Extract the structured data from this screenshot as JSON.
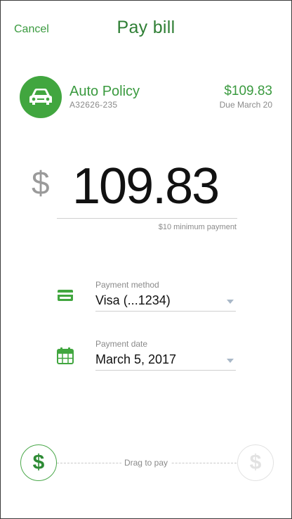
{
  "header": {
    "cancel_label": "Cancel",
    "title": "Pay bill"
  },
  "policy": {
    "icon": "car-icon",
    "name": "Auto Policy",
    "number": "A32626-235",
    "amount": "$109.83",
    "due": "Due March 20"
  },
  "payment": {
    "currency_symbol": "$",
    "amount": "109.83",
    "minimum_hint": "$10 minimum payment"
  },
  "method": {
    "icon": "credit-card-icon",
    "label": "Payment method",
    "value": "Visa (...1234)"
  },
  "date": {
    "icon": "calendar-icon",
    "label": "Payment date",
    "value": "March 5, 2017"
  },
  "slider": {
    "label": "Drag to pay",
    "handle_glyph": "$",
    "target_glyph": "$"
  },
  "colors": {
    "accent": "#3a9a3f",
    "accent_dark": "#2f7f35",
    "muted_text": "#8a8a8a",
    "caret": "#a9b8c8"
  }
}
